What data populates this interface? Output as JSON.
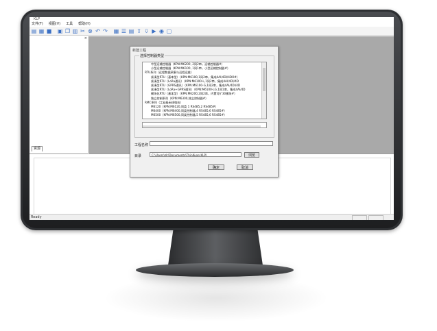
{
  "window": {
    "title": "KLP"
  },
  "menu": [
    "文件(F)",
    "视图(V)",
    "工具",
    "帮助(H)"
  ],
  "toolbar_icons": [
    "new-file-icon",
    "open-folder-icon",
    "save-icon",
    "save-all-icon",
    "copy-icon",
    "paste-icon",
    "cut-icon",
    "delete-icon",
    "undo-icon",
    "redo-icon",
    "grid-icon",
    "list-icon",
    "properties-icon",
    "upload-icon",
    "download-icon",
    "run-icon",
    "stop-icon",
    "window-icon"
  ],
  "left_panel": {
    "close": "×",
    "tab": "资源"
  },
  "status": {
    "text": "Ready"
  },
  "dialog": {
    "title": "新建工程",
    "group_label": "选择控制器类型",
    "tree_rows": [
      "中型运输控制器（KPN:M6200, 2同2串，运输控制器#）",
      "小型运输控制器（KPN:M6100, 1同1串，小型运输控制器#）",
      "RTU系列（远程数据采集与远程运维）",
      "紧凑型RTU（基本型）（KPN:M6100,1同2串，集成4AI/4DI/4DO#）",
      "紧凑型RTU（LoRa通讯）（KPN:M6100-L,1同2串，集成4AI/4DI/4D",
      "紧凑型RTU（GPRS通讯）（KPN:M6100-G,1同2串，集成4AI/4DI/4D",
      "紧凑型RTU（LoRa+GPRS通讯）（KPN:M6100-LG,1同1串，集成4AI/4D",
      "模块化RTU（基本型）（KPN:M6200,2同2串，内置可扩30模块#）",
      "独立控制系列（KPN:M6300,独立控制器#）",
      "RMC系列（工业级无线电台）",
      "M6120（KPN:M6120,同类 1 RS485,2 RS485#）",
      "M6400（KPN:M6400,同类控制器,4 RS485,6 RS485#）",
      "M6500（KPN:M6500,同类控制器,5 RS485,6 RS485#）"
    ],
    "name_label": "工程名称",
    "name_value": "",
    "dir_label": "目录",
    "dir_value": "C:\\Users\\zlr\\Documents\\ThinKuan KLP\\",
    "browse_label": "浏览",
    "ok_label": "确定",
    "cancel_label": "取消"
  }
}
